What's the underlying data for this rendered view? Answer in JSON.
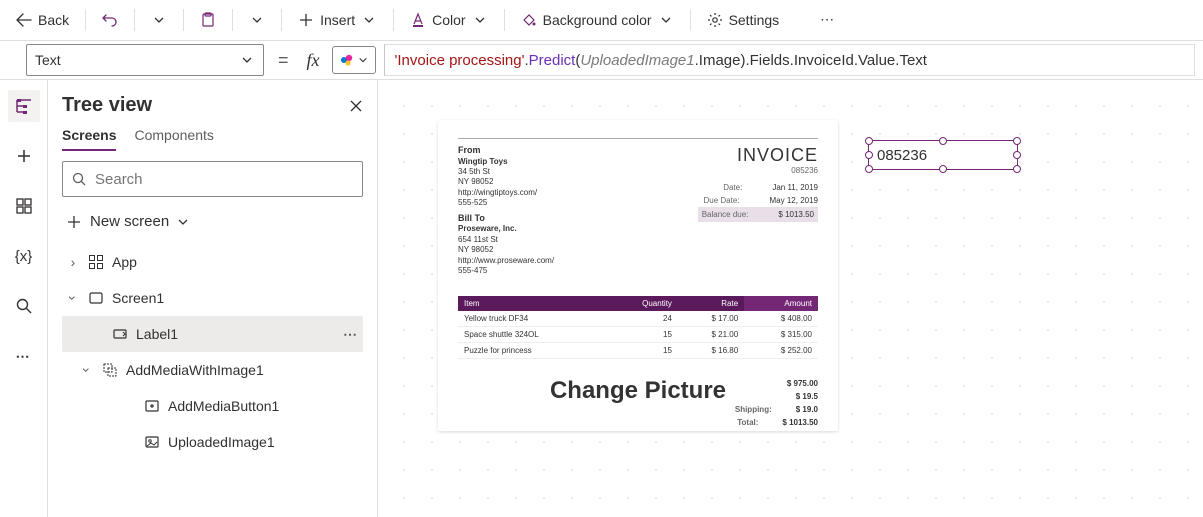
{
  "toolbar": {
    "back": "Back",
    "insert": "Insert",
    "color": "Color",
    "bgcolor": "Background color",
    "settings": "Settings"
  },
  "formula": {
    "property": "Text",
    "parts": {
      "str": "'Invoice processing'",
      "dot1": ".",
      "predict": "Predict",
      "open": "(",
      "arg": "UploadedImage1",
      "argSuffix": ".Image",
      "close": ")",
      "chain": ".Fields.InvoiceId.Value.Text"
    }
  },
  "tree": {
    "title": "Tree view",
    "tabs": {
      "screens": "Screens",
      "components": "Components"
    },
    "search_placeholder": "Search",
    "new_screen": "New screen",
    "items": {
      "app": "App",
      "screen1": "Screen1",
      "label1": "Label1",
      "addMedia": "AddMediaWithImage1",
      "addMediaBtn": "AddMediaButton1",
      "uploadedImg": "UploadedImage1"
    }
  },
  "canvas": {
    "selected_value": "085236",
    "invoice": {
      "title": "INVOICE",
      "number": "085236",
      "from_label": "From",
      "from": [
        "Wingtip Toys",
        "34 5th St",
        "NY 98052",
        "http://wingtiptoys.com/",
        "555-525"
      ],
      "billto_label": "Bill To",
      "billto": [
        "Proseware, Inc.",
        "654 11st St",
        "NY 98052",
        "http://www.proseware.com/",
        "555-475"
      ],
      "meta": {
        "date_k": "Date:",
        "date_v": "Jan 11, 2019",
        "due_k": "Due Date:",
        "due_v": "May 12, 2019",
        "bal_k": "Balance due:",
        "bal_v": "$ 1013.50"
      },
      "headers": {
        "item": "Item",
        "qty": "Quantity",
        "rate": "Rate",
        "amount": "Amount"
      },
      "rows": [
        {
          "item": "Yellow truck DF34",
          "qty": "24",
          "rate": "$ 17.00",
          "amount": "$ 408.00"
        },
        {
          "item": "Space shuttle 324OL",
          "qty": "15",
          "rate": "$ 21.00",
          "amount": "$ 315.00"
        },
        {
          "item": "Puzzle for princess",
          "qty": "15",
          "rate": "$ 16.80",
          "amount": "$ 252.00"
        }
      ],
      "change": "Change Picture",
      "totals": [
        {
          "k": "",
          "v": "$ 975.00"
        },
        {
          "k": "",
          "v": "$ 19.5"
        },
        {
          "k": "Shipping:",
          "v": "$ 19.0"
        },
        {
          "k": "Total:",
          "v": "$ 1013.50"
        }
      ]
    }
  }
}
